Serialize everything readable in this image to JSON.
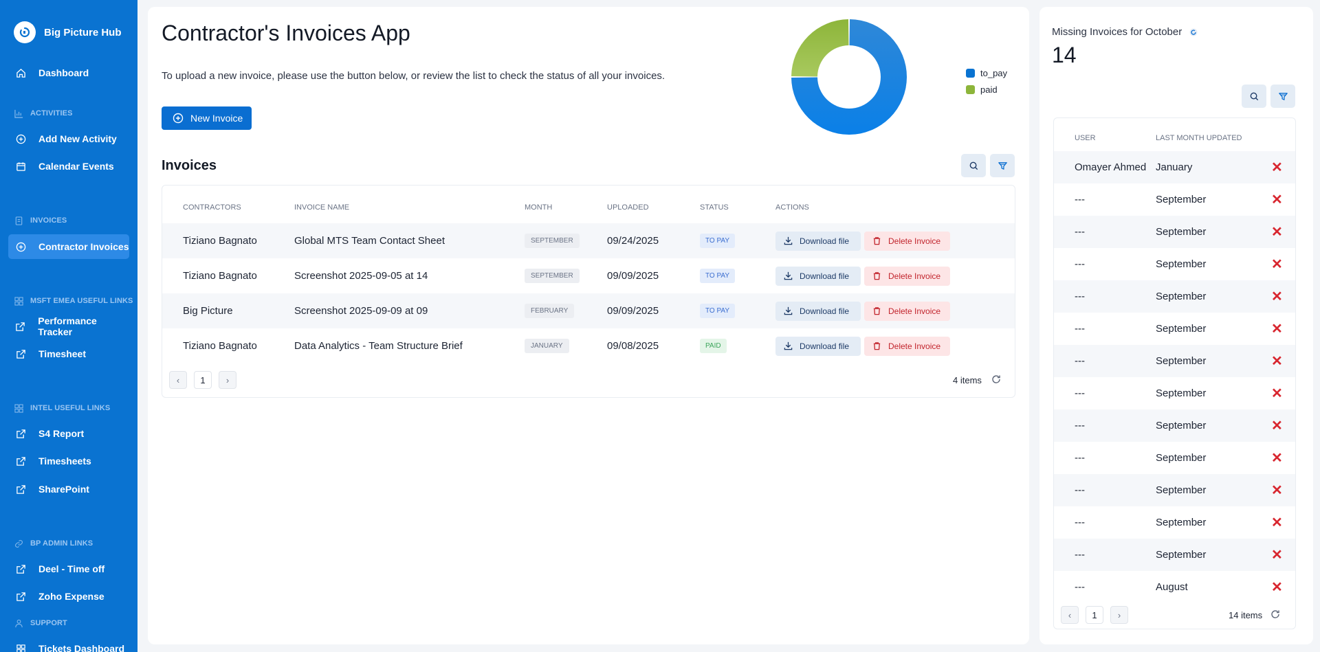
{
  "sidebar": {
    "brand": "Big Picture Hub",
    "dashboard": "Dashboard",
    "sections": {
      "activities": "ACTIVITIES",
      "invoices": "INVOICES",
      "msft": "MSFT EMEA USEFUL LINKS",
      "intel": "INTEL USEFUL LINKS",
      "bpadmin": "BP ADMIN LINKS",
      "support": "SUPPORT"
    },
    "items": {
      "add_activity": "Add New Activity",
      "calendar": "Calendar Events",
      "contractor_invoices": "Contractor Invoices",
      "performance": "Performance Tracker",
      "timesheet": "Timesheet",
      "s4": "S4 Report",
      "timesheets": "Timesheets",
      "sharepoint": "SharePoint",
      "deel": "Deel - Time off",
      "zoho": "Zoho Expense",
      "tickets": "Tickets Dashboard"
    }
  },
  "main": {
    "title": "Contractor's Invoices App",
    "intro": "To upload a new invoice, please use the button below, or review the list to check the status of all your invoices.",
    "new_invoice": "New Invoice",
    "invoices_title": "Invoices",
    "columns": [
      "CONTRACTORS",
      "INVOICE NAME",
      "MONTH",
      "UPLOADED",
      "STATUS",
      "ACTIONS"
    ],
    "rows": [
      {
        "contractor": "Tiziano Bagnato",
        "name": "Global MTS Team Contact Sheet",
        "month": "SEPTEMBER",
        "uploaded": "09/24/2025",
        "status": "TO PAY"
      },
      {
        "contractor": "Tiziano Bagnato",
        "name": "Screenshot 2025-09-05 at 14",
        "month": "SEPTEMBER",
        "uploaded": "09/09/2025",
        "status": "TO PAY"
      },
      {
        "contractor": "Big Picture",
        "name": "Screenshot 2025-09-09 at 09",
        "month": "FEBRUARY",
        "uploaded": "09/09/2025",
        "status": "TO PAY"
      },
      {
        "contractor": "Tiziano Bagnato",
        "name": "Data Analytics - Team Structure Brief",
        "month": "JANUARY",
        "uploaded": "09/08/2025",
        "status": "PAID"
      }
    ],
    "download_label": "Download file",
    "delete_label": "Delete Invoice",
    "page": "1",
    "items_count": "4 items",
    "prev": "‹",
    "next": "›"
  },
  "chart_data": {
    "type": "pie",
    "categories": [
      "to_pay",
      "paid"
    ],
    "values": [
      3,
      1
    ],
    "colors": [
      "#0a73d1",
      "#8db53a"
    ],
    "legend": [
      "to_pay",
      "paid"
    ]
  },
  "missing": {
    "label": "Missing Invoices for October",
    "count": "14",
    "columns": [
      "USER",
      "LAST MONTH UPDATED"
    ],
    "rows": [
      {
        "user": "Omayer Ahmed",
        "month": "January"
      },
      {
        "user": "---",
        "month": "September"
      },
      {
        "user": "---",
        "month": "September"
      },
      {
        "user": "---",
        "month": "September"
      },
      {
        "user": "---",
        "month": "September"
      },
      {
        "user": "---",
        "month": "September"
      },
      {
        "user": "---",
        "month": "September"
      },
      {
        "user": "---",
        "month": "September"
      },
      {
        "user": "---",
        "month": "September"
      },
      {
        "user": "---",
        "month": "September"
      },
      {
        "user": "---",
        "month": "September"
      },
      {
        "user": "---",
        "month": "September"
      },
      {
        "user": "---",
        "month": "September"
      },
      {
        "user": "---",
        "month": "August"
      }
    ],
    "x_label": "✕",
    "page": "1",
    "items_count": "14 items",
    "prev": "‹",
    "next": "›"
  },
  "colors": {
    "sidebar": "#0a73d1",
    "primary": "#0a6ed1",
    "paid": "#8db53a",
    "danger": "#d8262f"
  }
}
